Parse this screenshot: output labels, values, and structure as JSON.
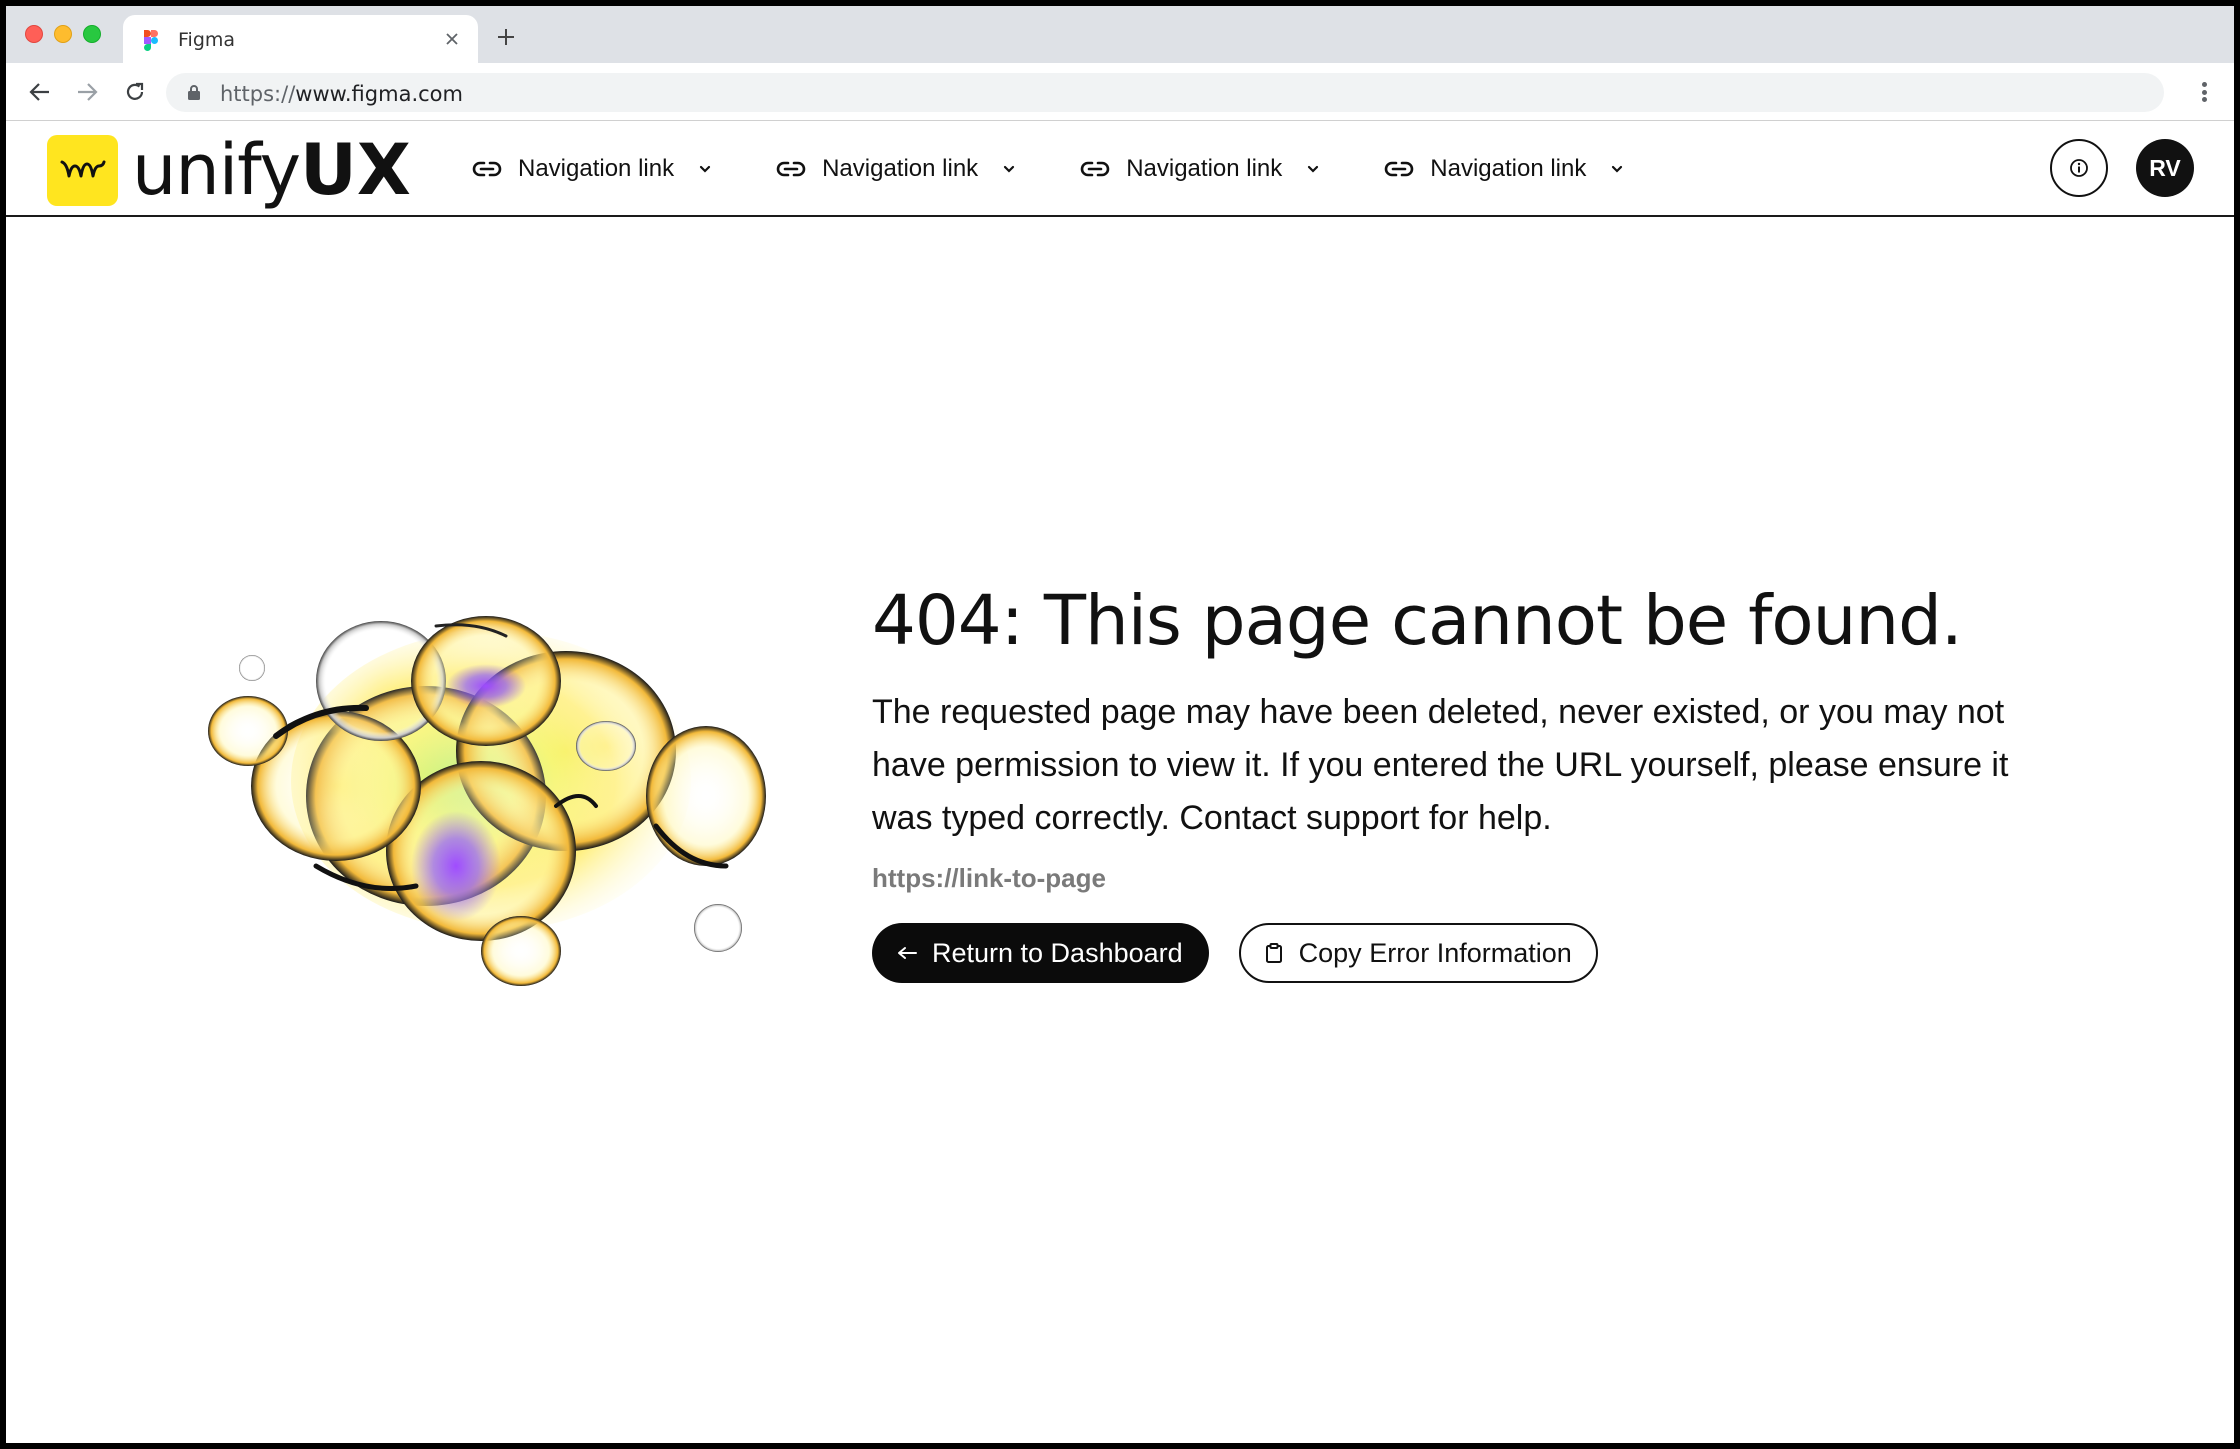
{
  "browser": {
    "tab_title": "Figma",
    "url_scheme": "https://",
    "url_host": "www.figma.com"
  },
  "header": {
    "logo_prefix": "unify",
    "logo_suffix": "UX",
    "nav_links": [
      {
        "label": "Navigation link"
      },
      {
        "label": "Navigation link"
      },
      {
        "label": "Navigation link"
      },
      {
        "label": "Navigation link"
      }
    ],
    "avatar_initials": "RV"
  },
  "error": {
    "title": "404: This page cannot be found.",
    "description": "The requested page may have been deleted, never existed, or you may not have permission to view it. If you entered the URL yourself, please ensure it was typed correctly. Contact support for help.",
    "url": "https://link-to-page"
  },
  "actions": {
    "primary_label": "Return to Dashboard",
    "secondary_label": "Copy Error Information"
  },
  "colors": {
    "accent": "#ffe51f",
    "primary_button": "#0b0b0b",
    "muted_text": "#7a7a7a"
  },
  "icons": {
    "logo": "wave-logo-icon",
    "nav": "link-icon",
    "dropdown": "chevron-down-icon",
    "info": "info-icon",
    "primary_action": "return-arrow-icon",
    "secondary_action": "clipboard-icon"
  }
}
